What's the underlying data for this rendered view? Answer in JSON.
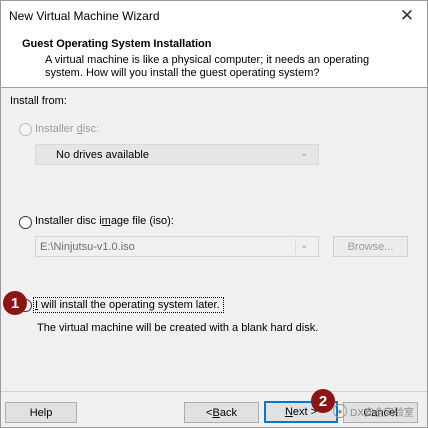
{
  "window": {
    "title": "New Virtual Machine Wizard",
    "close_glyph": "✕"
  },
  "header": {
    "title": "Guest Operating System Installation",
    "description": "A virtual machine is like a physical computer; it needs an operating system. How will you install the guest operating system?"
  },
  "install_from_label": "Install from:",
  "options": {
    "disc": {
      "label_pre": "Installer ",
      "label_u": "d",
      "label_post": "isc:",
      "selected": false,
      "enabled": false
    },
    "disc_combo": {
      "value": "No drives available"
    },
    "iso": {
      "label_pre": "Installer disc i",
      "label_u": "m",
      "label_post": "age file (iso):",
      "selected": false,
      "enabled": true
    },
    "iso_combo": {
      "value": "E:\\Ninjutsu-v1.0.iso"
    },
    "browse_label": "Browse...",
    "later": {
      "label_pre": "",
      "label_u": "I",
      "label_post": " will install the operating system later.",
      "selected": true
    },
    "later_desc": "The virtual machine will be created with a blank hard disk."
  },
  "buttons": {
    "help": "Help",
    "back_pre": "< ",
    "back_u": "B",
    "back_post": "ack",
    "next_pre": "",
    "next_u": "N",
    "next_post": "ext >",
    "cancel": "Cancel"
  },
  "markers": {
    "one": "1",
    "two": "2"
  },
  "watermark": {
    "text": "DX安全实验室"
  },
  "colors": {
    "accent": "#0078d7",
    "marker": "#8b1414"
  }
}
